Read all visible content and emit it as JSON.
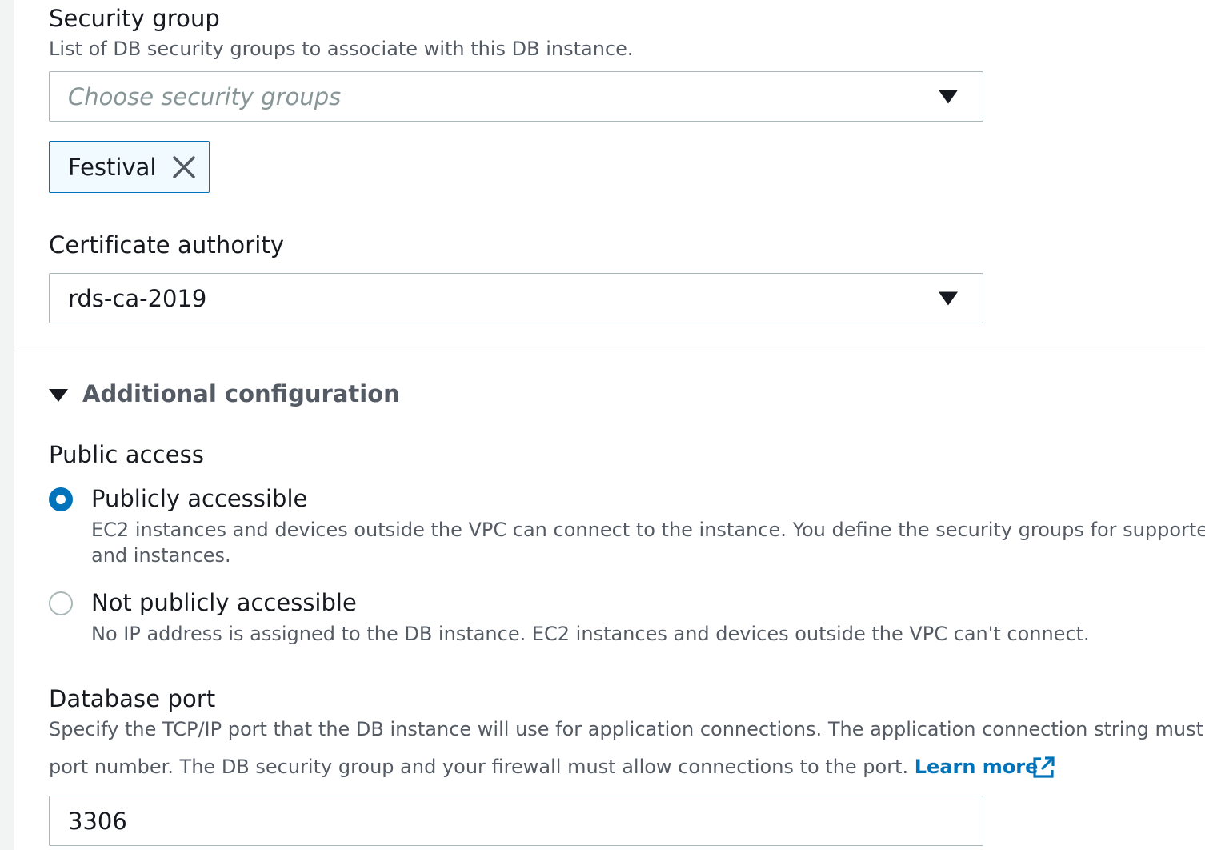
{
  "security_group": {
    "label": "Security group",
    "description": "List of DB security groups to associate with this DB instance.",
    "placeholder": "Choose security groups",
    "selected_tokens": [
      "Festival"
    ]
  },
  "certificate_authority": {
    "label": "Certificate authority",
    "value": "rds-ca-2019"
  },
  "additional_configuration": {
    "title": "Additional configuration",
    "expanded": true
  },
  "public_access": {
    "label": "Public access",
    "options": [
      {
        "label": "Publicly accessible",
        "description_line1": "EC2 instances and devices outside the VPC can connect to the instance. You define the security groups for supported c",
        "description_line2": "and instances.",
        "selected": true
      },
      {
        "label": "Not publicly accessible",
        "description_line1": "No IP address is assigned to the DB instance. EC2 instances and devices outside the VPC can't connect.",
        "selected": false
      }
    ]
  },
  "database_port": {
    "label": "Database port",
    "description_line1": "Specify the TCP/IP port that the DB instance will use for application connections. The application connection string must s",
    "description_line2": "port number. The DB security group and your firewall must allow connections to the port.",
    "learn_more": "Learn more",
    "value": "3306"
  },
  "colors": {
    "accent": "#0073bb",
    "token_background": "#f1faff",
    "text_primary": "#16191f",
    "text_secondary": "#545b64",
    "border": "#aab7b8"
  },
  "icons": {
    "token_remove": "close-icon",
    "dropdown": "caret-down-icon",
    "external_link": "external-link-icon"
  }
}
